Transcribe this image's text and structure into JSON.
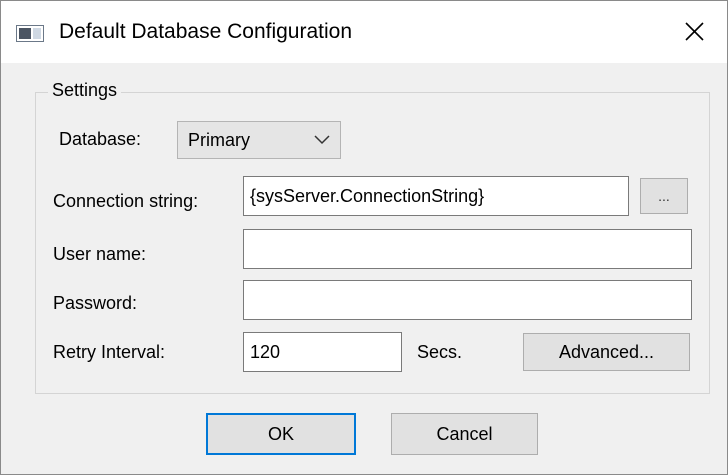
{
  "window": {
    "title": "Default Database Configuration",
    "close_glyph": "✕"
  },
  "settings": {
    "group_label": "Settings",
    "database": {
      "label": "Database:",
      "selected": "Primary",
      "icon": "chevron-down-icon"
    },
    "connection_string": {
      "label": "Connection string:",
      "value": "{sysServer.ConnectionString}",
      "browse_label": "..."
    },
    "user_name": {
      "label": "User name:",
      "value": ""
    },
    "password": {
      "label": "Password:",
      "value": ""
    },
    "retry_interval": {
      "label": "Retry Interval:",
      "value": "120",
      "unit": "Secs."
    },
    "advanced_label": "Advanced..."
  },
  "footer": {
    "ok_label": "OK",
    "cancel_label": "Cancel"
  },
  "colors": {
    "dialog_background": "#f0f0f0",
    "titlebar_background": "#ffffff",
    "default_button_border": "#0078d7"
  }
}
